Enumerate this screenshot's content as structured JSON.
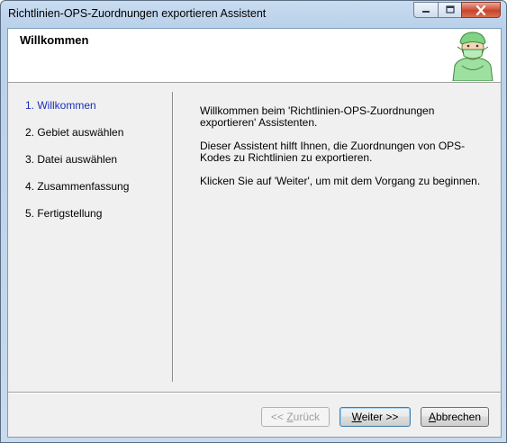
{
  "window": {
    "title": "Richtlinien-OPS-Zuordnungen exportieren Assistent",
    "caption_buttons": [
      "minimize-icon",
      "maximize-icon",
      "close-icon"
    ]
  },
  "header": {
    "title": "Willkommen",
    "icon": "surgeon-icon"
  },
  "steps": [
    {
      "label": "1. Willkommen",
      "active": true
    },
    {
      "label": "2. Gebiet auswählen",
      "active": false
    },
    {
      "label": "3. Datei auswählen",
      "active": false
    },
    {
      "label": "4. Zusammenfassung",
      "active": false
    },
    {
      "label": "5. Fertigstellung",
      "active": false
    }
  ],
  "content": {
    "paragraph1": "Willkommen beim 'Richtlinien-OPS-Zuordnungen exportieren' Assistenten.",
    "paragraph2": "Dieser Assistent hilft Ihnen, die Zuordnungen von OPS-Kodes zu Richtlinien zu exportieren.",
    "paragraph3": "Klicken Sie auf 'Weiter', um mit dem Vorgang zu beginnen."
  },
  "buttons": {
    "back": {
      "prefix": "<< ",
      "mnemonic": "Z",
      "rest": "urück",
      "enabled": false
    },
    "next": {
      "prefix": "",
      "mnemonic": "W",
      "rest": "eiter >>",
      "enabled": true
    },
    "cancel": {
      "prefix": "",
      "mnemonic": "A",
      "rest": "bbrechen",
      "enabled": true
    }
  },
  "colors": {
    "active_step": "#1a2fbd",
    "header_background": "#ffffff",
    "client_background": "#f0f0f0"
  }
}
